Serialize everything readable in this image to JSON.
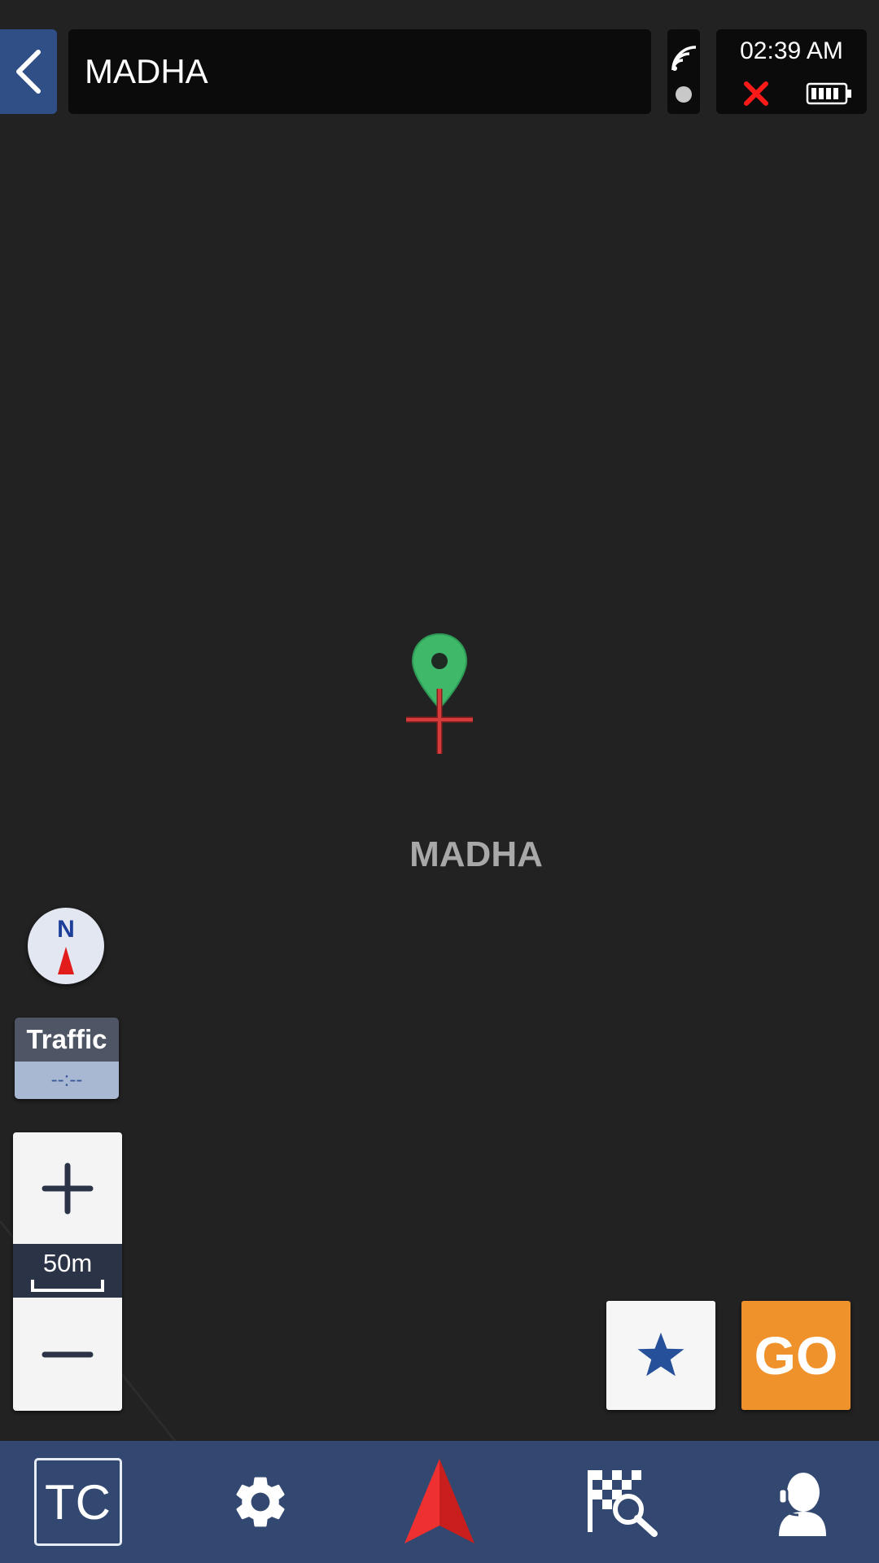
{
  "header": {
    "title": "MADHA",
    "back_icon": "chevron-left-icon",
    "signal_icon": "wifi-signal-icon",
    "time": "02:39 AM",
    "gps_status_icon": "close-icon",
    "battery_icon": "battery-icon"
  },
  "map": {
    "place_label": "MADHA",
    "pin_icon": "location-pin-icon",
    "crosshair_icon": "crosshair-icon"
  },
  "controls": {
    "compass_label": "N",
    "traffic_label": "Traffic",
    "traffic_value": "--:--",
    "scale": "50m",
    "zoom_in_icon": "plus-icon",
    "zoom_out_icon": "minus-icon"
  },
  "actions": {
    "favorite_icon": "star-icon",
    "go_label": "GO"
  },
  "bottom_nav": {
    "tc_label": "TC",
    "settings_icon": "gear-icon",
    "navigate_icon": "navigation-arrow-icon",
    "destination_icon": "checkered-flag-search-icon",
    "support_icon": "headset-support-icon"
  },
  "colors": {
    "map_background": "#222222",
    "accent_blue": "#324870",
    "go_orange": "#f0922b",
    "pin_green": "#3fb86a",
    "crosshair_red": "#d43b3b"
  }
}
